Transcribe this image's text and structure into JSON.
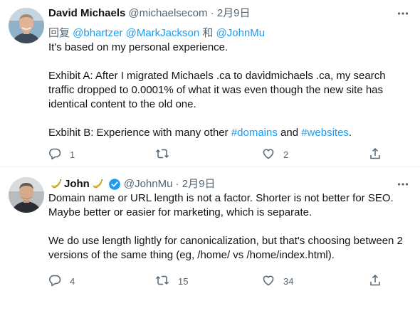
{
  "tweets": [
    {
      "author_name": "David Michaels",
      "handle_date": "@michaelsecom · 2月9日",
      "reply_prefix": "回复 ",
      "reply_mentions": "@bhartzer @MarkJackson",
      "reply_and": " 和 ",
      "reply_mention_last": "@JohnMu",
      "para1": "It's based on my personal experience.",
      "para2": "Exhibit A: After I migrated Michaels .ca to davidmichaels .ca, my search traffic dropped to 0.0001% of what it was even though the new site has identical content to the old one.",
      "para3_start": "Exbihit B: Experience with many other ",
      "hashtag1": "#domains",
      "para3_and": " and ",
      "hashtag2": "#websites",
      "para3_end": ".",
      "reply_count": "1",
      "retweet_count": "",
      "like_count": "2"
    },
    {
      "author_name": "John",
      "handle_date": "@JohnMu · 2月9日",
      "para1": "Domain name or URL length is not a factor. Shorter is not better for SEO. Maybe better or easier for marketing, which is separate.",
      "para2": "We do use length lightly for canonicalization, but that's choosing between 2 versions of the same thing (eg, /home/ vs /home/index.html).",
      "reply_count": "4",
      "retweet_count": "15",
      "like_count": "34"
    }
  ],
  "icons": {
    "more": "more-icon",
    "reply": "reply-icon",
    "retweet": "retweet-icon",
    "like": "like-icon",
    "share": "share-icon",
    "verified": "verified-badge-icon",
    "banana": "banana-emoji-icon"
  },
  "colors": {
    "link": "#1d9bf0",
    "secondary_text": "#536471",
    "primary_text": "#0f1419",
    "divider": "#eff3f4"
  }
}
